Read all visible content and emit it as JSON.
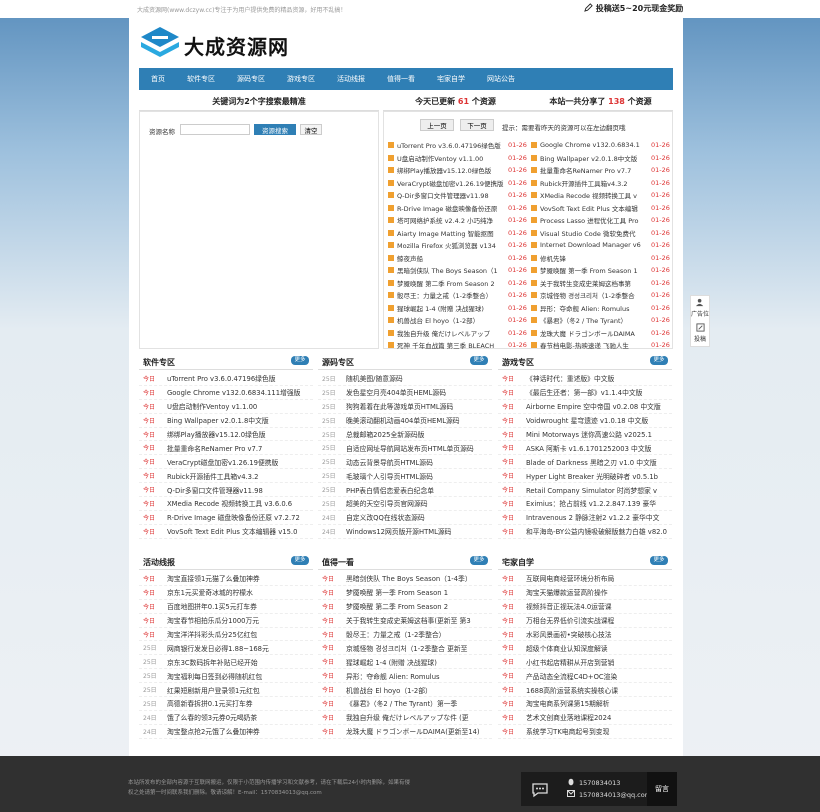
{
  "topbar": {
    "notice": "大成资源网(www.dczyw.cc)专注于为用户提供免费的精品资源，好用不乱搞！",
    "promo": "投稿送5~20元现金奖励"
  },
  "logo": {
    "text": "大成资源网"
  },
  "nav": [
    "首页",
    "软件专区",
    "源码专区",
    "游戏专区",
    "活动线报",
    "值得一看",
    "宅家自学",
    "网站公告"
  ],
  "search": {
    "header_pre": "关键词为2个字搜索最精准",
    "label": "资源名称",
    "placeholder": "",
    "submit": "资源搜索",
    "reset": "清空"
  },
  "updated": {
    "pre": "今天已更新 ",
    "count": "61",
    "post": " 个资源"
  },
  "shared": {
    "pre": "本站一共分享了 ",
    "count": "138",
    "post": " 个资源"
  },
  "pager": {
    "prev": "上一页",
    "next": "下一页",
    "note": "提示：需要看昨天的资源可以在左边翻页哦"
  },
  "colors": {
    "accent": "#2f7fb5",
    "date": "#d33333",
    "icon": "#f0a030"
  },
  "latest_left": [
    {
      "t": "uTorrent Pro v3.6.0.47196绿色版",
      "d": "01-26"
    },
    {
      "t": "U盘启动制作Ventoy v1.1.00",
      "d": "01-26"
    },
    {
      "t": "绑绑Play播放器v15.12.0绿色版",
      "d": "01-26"
    },
    {
      "t": "VeraCrypt磁盘加密v1.26.19便携版",
      "d": "01-26"
    },
    {
      "t": "Q-Dir多窗口文件管理器v11.98",
      "d": "01-26"
    },
    {
      "t": "R-Drive Image 磁盘映像备份还原",
      "d": "01-26"
    },
    {
      "t": "塔可网络护系统 v2.4.2 小巧纯净",
      "d": "01-26"
    },
    {
      "t": "Aiarty Image Matting 智能抠图",
      "d": "01-26"
    },
    {
      "t": "Mozilla Firefox 火狐浏览器 v134",
      "d": "01-26"
    },
    {
      "t": "鲸夜声船",
      "d": "01-26"
    },
    {
      "t": "黑暗剑侠队 The Boys Season（1",
      "d": "01-26"
    },
    {
      "t": "梦魇唤醒 第二季 From Season 2",
      "d": "01-26"
    },
    {
      "t": "骰尽王：力量之戒（1-2季整合）",
      "d": "01-26"
    },
    {
      "t": "猩球崛起 1-4 (附赠 决战猩球)",
      "d": "01-26"
    },
    {
      "t": "机兽战台 El hoyo（1-2部）",
      "d": "01-26"
    },
    {
      "t": "我独自升级 俺だけレベルアップ",
      "d": "01-26"
    },
    {
      "t": "死神 千年血战篇 第三季 BLEACH",
      "d": "01-26"
    }
  ],
  "latest_right": [
    {
      "t": "Google Chrome v132.0.6834.1",
      "d": "01-26"
    },
    {
      "t": "Bing Wallpaper v2.0.1.8中文版",
      "d": "01-26"
    },
    {
      "t": "批量重命名ReNamer Pro v7.7",
      "d": "01-26"
    },
    {
      "t": "Rubick开源插件工具箱v4.3.2",
      "d": "01-26"
    },
    {
      "t": "XMedia Recode 视频转换工具 v",
      "d": "01-26"
    },
    {
      "t": "VovSoft Text Edit Plus 文本编辑",
      "d": "01-26"
    },
    {
      "t": "Process Lasso 进程优化工具 Pro",
      "d": "01-26"
    },
    {
      "t": "Visual Studio Code 微软免费代",
      "d": "01-26"
    },
    {
      "t": "Internet Download Manager v6",
      "d": "01-26"
    },
    {
      "t": "修机先锋",
      "d": "01-26"
    },
    {
      "t": "梦魇唤醒 第一季 From Season 1",
      "d": "01-26"
    },
    {
      "t": "关于我转生变成史莱姆这档事第",
      "d": "01-26"
    },
    {
      "t": "京城怪物 경성크리처（1-2季整合",
      "d": "01-26"
    },
    {
      "t": "异形：夺命舰 Alien: Romulus",
      "d": "01-26"
    },
    {
      "t": "《暴君》（冬2 / The Tyrant）",
      "d": "01-26"
    },
    {
      "t": "龙珠大魔 ドラゴンボールDAIMA",
      "d": "01-26"
    },
    {
      "t": "春节档电影-热映速递 飞驰人生",
      "d": "01-26"
    }
  ],
  "panels": [
    {
      "title": "软件专区",
      "more": "更多",
      "items": [
        {
          "d": "今日",
          "t": "uTorrent Pro v3.6.0.47196绿色版"
        },
        {
          "d": "今日",
          "t": "Google Chrome v132.0.6834.111增强版"
        },
        {
          "d": "今日",
          "t": "U盘启动制作Ventoy v1.1.00"
        },
        {
          "d": "今日",
          "t": "Bing Wallpaper v2.0.1.8中文版"
        },
        {
          "d": "今日",
          "t": "绑绑Play播放器v15.12.0绿色版"
        },
        {
          "d": "今日",
          "t": "批量重命名ReNamer Pro v7.7"
        },
        {
          "d": "今日",
          "t": "VeraCrypt磁盘加密v1.26.19便携版"
        },
        {
          "d": "今日",
          "t": "Rubick开源插件工具箱v4.3.2"
        },
        {
          "d": "今日",
          "t": "Q-Dir多窗口文件管理器v11.98"
        },
        {
          "d": "今日",
          "t": "XMedia Recode 视频转换工具 v3.6.0.6"
        },
        {
          "d": "今日",
          "t": "R-Drive Image 磁盘映像备份还原 v7.2.72"
        },
        {
          "d": "今日",
          "t": "VovSoft Text Edit Plus 文本编辑器 v15.0"
        }
      ]
    },
    {
      "title": "源码专区",
      "more": "更多",
      "items": [
        {
          "d": "25日",
          "t": "随机美图/随意源码"
        },
        {
          "d": "25日",
          "t": "发色星空月亮404单页HEML源码"
        },
        {
          "d": "25日",
          "t": "狗狗着着在此等游戏单页HTML源码"
        },
        {
          "d": "25日",
          "t": "晚美滚动翻机动画404单页HEML源码"
        },
        {
          "d": "25日",
          "t": "总裁邮箱2025全新源码版"
        },
        {
          "d": "25日",
          "t": "自适应网址导航网站发布页HTML单页源码"
        },
        {
          "d": "25日",
          "t": "动态云背景导航页HTML源码"
        },
        {
          "d": "25日",
          "t": "毛玻璃个人引导页HTML源码"
        },
        {
          "d": "25日",
          "t": "PHP表白情侣恋爱表白纪念单"
        },
        {
          "d": "25日",
          "t": "超美的天空引导页官网源码"
        },
        {
          "d": "24日",
          "t": "自定义改QQ在线状态源码"
        },
        {
          "d": "24日",
          "t": "Windows12网页版开源HTML源码"
        }
      ]
    },
    {
      "title": "游戏专区",
      "more": "更多",
      "items": [
        {
          "d": "今日",
          "t": "《神话时代：重述版》中文版"
        },
        {
          "d": "今日",
          "t": "《最后生还者：第一部》v1.1.4中文版"
        },
        {
          "d": "今日",
          "t": "Airborne Empire 空中帝国 v0.2.08 中文版"
        },
        {
          "d": "今日",
          "t": "Voidwrought 星穹遗迹 v1.0.18 中文版"
        },
        {
          "d": "今日",
          "t": "Mini Motorways 迷你高速公路 v2025.1"
        },
        {
          "d": "今日",
          "t": "ASKA 阿斯卡 v1.6.1701252003 中文版"
        },
        {
          "d": "今日",
          "t": "Blade of Darkness 黑暗之刃 v1.0 中文版"
        },
        {
          "d": "今日",
          "t": "Hyper Light Breaker 光明破碎者 v0.5.1b"
        },
        {
          "d": "今日",
          "t": "Retail Company Simulator 时尚梦想家 v"
        },
        {
          "d": "今日",
          "t": "Eximius：抢占前线 v1.2.2.847.139 豪华"
        },
        {
          "d": "今日",
          "t": "Intravenous 2 静脉注射2 v1.2.2 豪华中文"
        },
        {
          "d": "今日",
          "t": "和平海岛-BY公益内镜吸破解版魅力白雄 v82.0"
        }
      ]
    },
    {
      "title": "活动线报",
      "more": "更多",
      "items": [
        {
          "d": "今日",
          "t": "淘宝直接领1元猫了么叠加神券"
        },
        {
          "d": "今日",
          "t": "京东1元买爱奇冰城的柠檬水"
        },
        {
          "d": "今日",
          "t": "百度地图拼年0.1买5元打车券"
        },
        {
          "d": "今日",
          "t": "淘宝春节相拍乐瓜分1000万元"
        },
        {
          "d": "今日",
          "t": "淘宝洋洋抖彩头瓜分25亿红包"
        },
        {
          "d": "25日",
          "t": "网商银行发发日必得1.88~168元"
        },
        {
          "d": "25日",
          "t": "京东3C数码拆年补贴已经开始"
        },
        {
          "d": "25日",
          "t": "淘宝福利每日签到必得随机红包"
        },
        {
          "d": "25日",
          "t": "红果短剧新用户登录领1元红包"
        },
        {
          "d": "25日",
          "t": "高德新春拆拼0.1元买打车券"
        },
        {
          "d": "24日",
          "t": "饿了么春的领3元券0元喝奶茶"
        },
        {
          "d": "24日",
          "t": "淘宝整点抢2元饿了么叠加神券"
        }
      ]
    },
    {
      "title": "值得一看",
      "more": "更多",
      "items": [
        {
          "d": "今日",
          "t": "黑暗剑侠队 The Boys Season（1-4季）"
        },
        {
          "d": "今日",
          "t": "梦魇唤醒 第一季 From Season 1"
        },
        {
          "d": "今日",
          "t": "梦魇唤醒 第二季 From Season 2"
        },
        {
          "d": "今日",
          "t": "关于我转生变成史莱姆这档事(更新至 第3"
        },
        {
          "d": "今日",
          "t": "骰尽王：力量之戒（1-2季整合）"
        },
        {
          "d": "今日",
          "t": "京城怪物 경성크리처（1-2季整合 更新至"
        },
        {
          "d": "今日",
          "t": "猩球崛起 1-4 (附赠 决战猩球)"
        },
        {
          "d": "今日",
          "t": "异形：夺命舰 Alien: Romulus"
        },
        {
          "d": "今日",
          "t": "机兽战台 El hoyo（1-2部）"
        },
        {
          "d": "今日",
          "t": "《暴君》（冬2 / The Tyrant）第一季"
        },
        {
          "d": "今日",
          "t": "我独自升级 俺だけレベルアップな件 (更"
        },
        {
          "d": "今日",
          "t": "龙珠大魔 ドラゴンボールDAIMA(更新至14)"
        }
      ]
    },
    {
      "title": "宅家自学",
      "more": "更多",
      "items": [
        {
          "d": "今日",
          "t": "互联网电商经营环境分析布局"
        },
        {
          "d": "今日",
          "t": "淘宝天猫爆款运营高阶操作"
        },
        {
          "d": "今日",
          "t": "视频抖音正视玩法4.0运营课"
        },
        {
          "d": "今日",
          "t": "万相台无界低价引流实战课程"
        },
        {
          "d": "今日",
          "t": "水彩风景画初•突破核心技法"
        },
        {
          "d": "今日",
          "t": "超级个体商业认知深度解读"
        },
        {
          "d": "今日",
          "t": "小红书起店精耕从开店到营销"
        },
        {
          "d": "今日",
          "t": "产品动态全流程C4D+OC渲染"
        },
        {
          "d": "今日",
          "t": "1688高阶运营系统实操核心课"
        },
        {
          "d": "今日",
          "t": "淘宝电商系列课第15期解析"
        },
        {
          "d": "今日",
          "t": "艺术文创商业落地课程2024"
        },
        {
          "d": "今日",
          "t": "系统学习TK电商起号到变现"
        }
      ]
    }
  ],
  "side": {
    "ad": "广告位",
    "submit": "投稿"
  },
  "footer": {
    "text": "本站所发布的全部内容源于互联网搬运，仅限于小范围内传播学习和文献参考，请在下载后24小时内删除，如果有侵权之处请第一时间联系我们删除。敬请谅解！E-mail：1570834013@qq.com",
    "qq": "1570834013",
    "mail": "1570834013@qq.com",
    "msg": "留言"
  }
}
